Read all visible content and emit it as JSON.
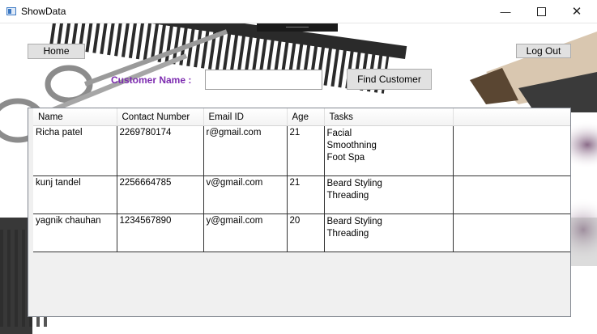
{
  "window": {
    "title": "ShowData",
    "minimize_label": "—",
    "close_label": "✕"
  },
  "toolbar": {
    "home_label": "Home",
    "logout_label": "Log Out",
    "customer_name_label": "Customer Name :",
    "customer_name_value": "",
    "find_label": "Find Customer"
  },
  "table": {
    "columns": [
      "Name",
      "Contact Number",
      "Email ID",
      "Age",
      "Tasks",
      ""
    ],
    "rows": [
      {
        "name": "Richa patel",
        "contact": "2269780174",
        "email": "r@gmail.com",
        "age": "21",
        "tasks": [
          "Facial",
          "Smoothning",
          "Foot Spa"
        ]
      },
      {
        "name": "kunj tandel",
        "contact": "2256664785",
        "email": "v@gmail.com",
        "age": "21",
        "tasks": [
          "Beard Styling",
          "Threading"
        ]
      },
      {
        "name": "yagnik chauhan",
        "contact": "1234567890",
        "email": "y@gmail.com",
        "age": "20",
        "tasks": [
          "Beard Styling",
          "Threading"
        ]
      }
    ]
  },
  "colors": {
    "label_purple": "#7d2bb0",
    "button_face": "#e1e1e1",
    "grid_background": "#f0f0f0"
  }
}
